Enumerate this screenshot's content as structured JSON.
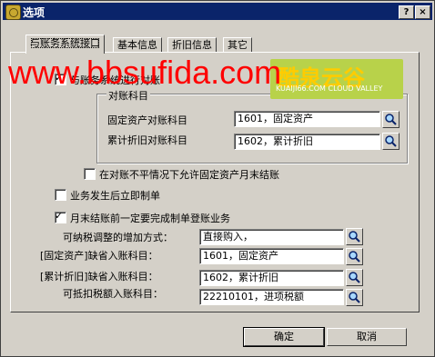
{
  "window": {
    "title": "选项",
    "help_button": "?",
    "close_button": "×"
  },
  "tabs": [
    {
      "label": "与账务系统接口"
    },
    {
      "label": "基本信息"
    },
    {
      "label": "折旧信息"
    },
    {
      "label": "其它"
    }
  ],
  "options": {
    "reconcile_check_label": "与账务系统进行对账",
    "reconcile_checked": true,
    "group_title": "对账科目",
    "fixed_asset_account_label": "固定资产对账科目",
    "fixed_asset_account_value": "1601，固定资产",
    "depreciation_account_label": "累计折旧对账科目",
    "depreciation_account_value": "1602，累计折旧",
    "allow_close_label": "在对账不平情况下允许固定资产月末结账",
    "allow_close_checked": false,
    "immediate_voucher_label": "业务发生后立即制单",
    "immediate_voucher_checked": false,
    "month_end_label": "月末结账前一定要完成制单登账业务",
    "month_end_checked": true,
    "tax_adjust_label": "可纳税调整的增加方式：",
    "tax_adjust_value": "直接购入，",
    "default_fixed_asset_label": "[固定资产]缺省入账科目：",
    "default_fixed_asset_value": "1601，固定资产",
    "default_depreciation_label": "[累计折旧]缺省入账科目：",
    "default_depreciation_value": "1602，累计折旧",
    "deductible_tax_label": "可抵扣税额入账科目：",
    "deductible_tax_value": "22210101，进项税额"
  },
  "buttons": {
    "ok": "确定",
    "cancel": "取消"
  },
  "watermark": {
    "text": "www.bbsufida.com",
    "logo_text": "酷泉云谷",
    "logo_subtext": "KUAIJI66.COM CLOUD VALLEY"
  }
}
